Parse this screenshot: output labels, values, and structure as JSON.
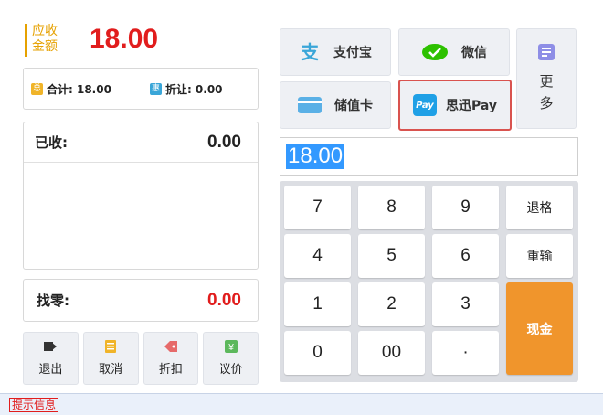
{
  "due": {
    "label_line1": "应收",
    "label_line2": "金额",
    "amount": "18.00"
  },
  "summary": {
    "total_icon": "总",
    "total_label": "合计: 18.00",
    "discount_icon": "惠",
    "discount_label": "折让: 0.00"
  },
  "received": {
    "label": "已收:",
    "value": "0.00"
  },
  "change": {
    "label": "找零:",
    "value": "0.00"
  },
  "actions": [
    {
      "label": "退出",
      "icon": "exit-icon",
      "color": "#333333"
    },
    {
      "label": "取消",
      "icon": "cancel-icon",
      "color": "#f0b429"
    },
    {
      "label": "折扣",
      "icon": "discount-tag-icon",
      "color": "#e66a6a"
    },
    {
      "label": "议价",
      "icon": "yen-icon",
      "color": "#5cb85c"
    }
  ],
  "payments": {
    "alipay": "支付宝",
    "wechat": "微信",
    "stored_card": "储值卡",
    "sixun_pay": "思迅Pay",
    "sixun_logo": "Pay",
    "more_line1": "更",
    "more_line2": "多"
  },
  "amount_input": "18.00",
  "keypad": {
    "k7": "7",
    "k8": "8",
    "k9": "9",
    "backspace": "退格",
    "k4": "4",
    "k5": "5",
    "k6": "6",
    "reenter": "重输",
    "k1": "1",
    "k2": "2",
    "k3": "3",
    "k0": "0",
    "k00": "00",
    "dot": "·",
    "cash": "现金"
  },
  "status": "提示信息",
  "colors": {
    "accent_red": "#e11d1d",
    "cash_orange": "#f0952c",
    "label_gold": "#e6a100",
    "selected_border": "#d9534f"
  }
}
